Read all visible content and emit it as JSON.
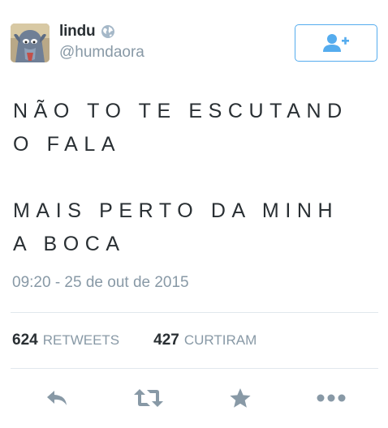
{
  "user": {
    "display_name": "lindu",
    "handle": "@humdaora",
    "verified_icon": "globe-icon"
  },
  "follow_button": {
    "icon": "add-user-icon",
    "color": "#55acee"
  },
  "tweet": {
    "text": "NÃO TO TE ESCUTAND\nO FALA\n\nMAIS PERTO DA MINH\nA BOCA",
    "timestamp": "09:20 - 25 de out de 2015"
  },
  "stats": {
    "retweets": {
      "count": "624",
      "label": "RETWEETS"
    },
    "likes": {
      "count": "427",
      "label": "CURTIRAM"
    }
  },
  "actions": [
    {
      "name": "reply",
      "icon": "reply-icon"
    },
    {
      "name": "retweet",
      "icon": "retweet-icon"
    },
    {
      "name": "like",
      "icon": "star-icon"
    },
    {
      "name": "more",
      "icon": "more-icon"
    }
  ],
  "colors": {
    "accent": "#55acee",
    "icon_gray": "#8899a6",
    "text": "#292f33"
  }
}
